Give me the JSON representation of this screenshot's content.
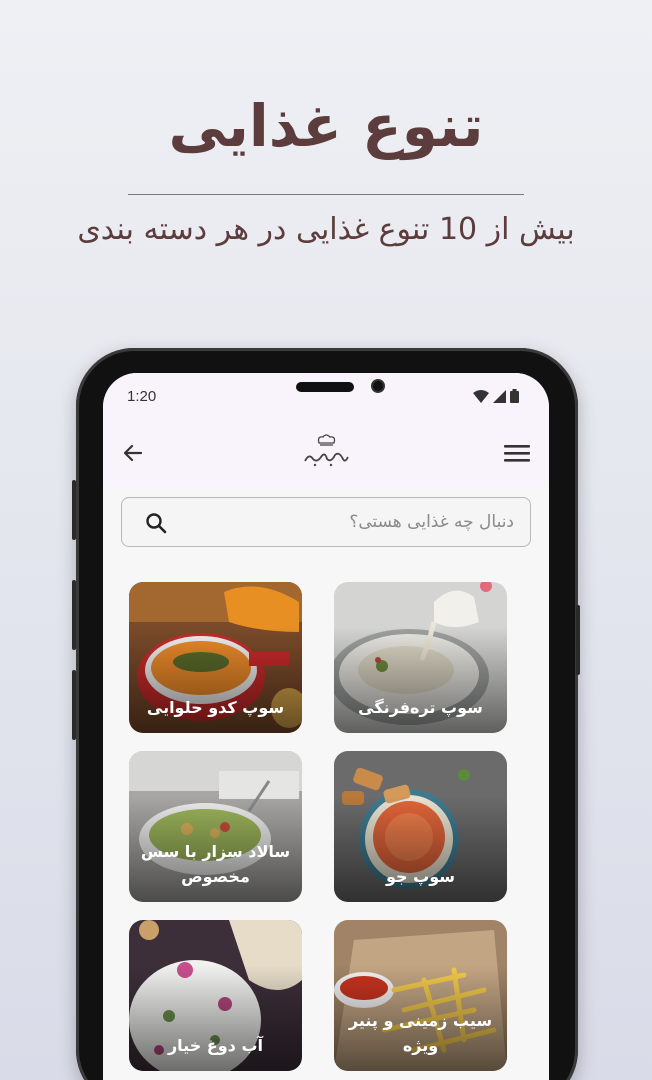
{
  "promo": {
    "title": "تنوع غذایی",
    "subtitle": "بیش از 10 تنوع غذایی در هر دسته بندی"
  },
  "status_bar": {
    "time": "1:20"
  },
  "app_bar": {
    "back_icon": "arrow-left-icon",
    "logo_icon": "chef-hat-logo-icon",
    "menu_icon": "hamburger-menu-icon"
  },
  "search": {
    "placeholder": "دنبال چه غذایی هستی؟",
    "icon": "search-icon"
  },
  "foods": [
    {
      "label": "سوپ تره‌فرنگی"
    },
    {
      "label": "سوپ کدو حلوایی"
    },
    {
      "label": "سوپ جو"
    },
    {
      "label": "سالاد سزار با سس مخصوص"
    },
    {
      "label": "سیب زمینی و پنیر ویژه"
    },
    {
      "label": "آب دوغ خیار"
    }
  ]
}
